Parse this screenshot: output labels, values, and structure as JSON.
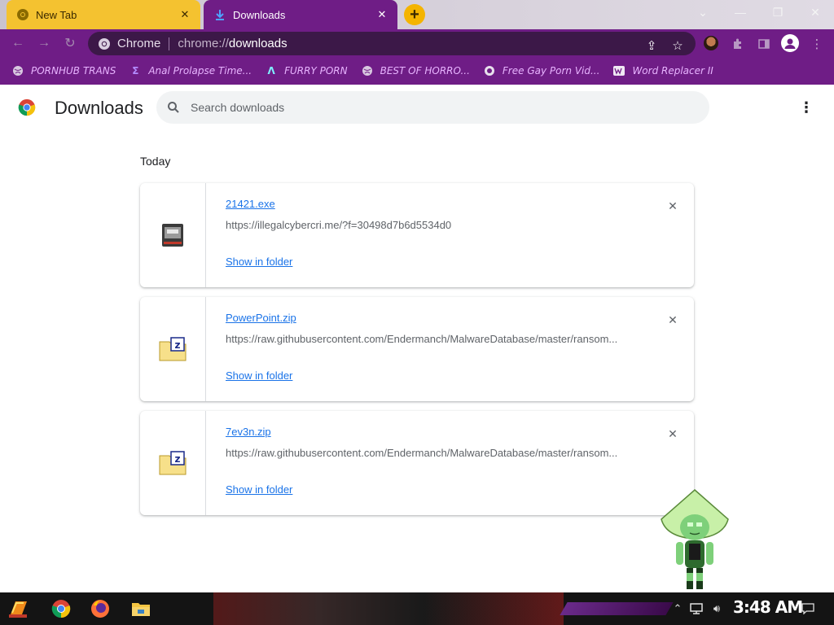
{
  "tabs": [
    {
      "title": "New Tab",
      "icon": "chrome-icon",
      "active": false
    },
    {
      "title": "Downloads",
      "icon": "download-icon",
      "active": true
    }
  ],
  "window_controls": [
    "chevron-down-icon",
    "minimize-icon",
    "restore-icon",
    "close-icon"
  ],
  "omnibox": {
    "site_label": "Chrome",
    "url_prefix": "chrome://",
    "url_path": "downloads"
  },
  "bookmarks": [
    {
      "label": "PORNHUB TRANS",
      "icon": "globe-icon"
    },
    {
      "label": "Anal Prolapse Time...",
      "icon": "sigma-icon"
    },
    {
      "label": "FURRY PORN",
      "icon": "lambda-icon"
    },
    {
      "label": "BEST OF HORRO...",
      "icon": "globe-icon"
    },
    {
      "label": "Free Gay Porn Vid...",
      "icon": "site-icon"
    },
    {
      "label": "Word Replacer II",
      "icon": "wr-icon"
    }
  ],
  "page": {
    "title": "Downloads",
    "search_placeholder": "Search downloads",
    "date_label": "Today"
  },
  "downloads": [
    {
      "filename": "21421.exe",
      "url": "https://illegalcybercri.me/?f=30498d7b6d5534d0",
      "action": "Show in folder",
      "icon": "exe-file-icon"
    },
    {
      "filename": "PowerPoint.zip",
      "url": "https://raw.githubusercontent.com/Endermanch/MalwareDatabase/master/ransom...",
      "action": "Show in folder",
      "icon": "zip-file-icon"
    },
    {
      "filename": "7ev3n.zip",
      "url": "https://raw.githubusercontent.com/Endermanch/MalwareDatabase/master/ransom...",
      "action": "Show in folder",
      "icon": "zip-file-icon"
    }
  ],
  "taskbar": {
    "clock": "3:48 AM",
    "apps": [
      "start-icon",
      "chrome-icon",
      "firefox-icon",
      "file-explorer-icon"
    ]
  },
  "colors": {
    "theme_purple": "#6f1d86",
    "active_tab_yellow": "#f4c230",
    "link_blue": "#1a73e8",
    "bookmark_text": "#e8b4ff"
  }
}
